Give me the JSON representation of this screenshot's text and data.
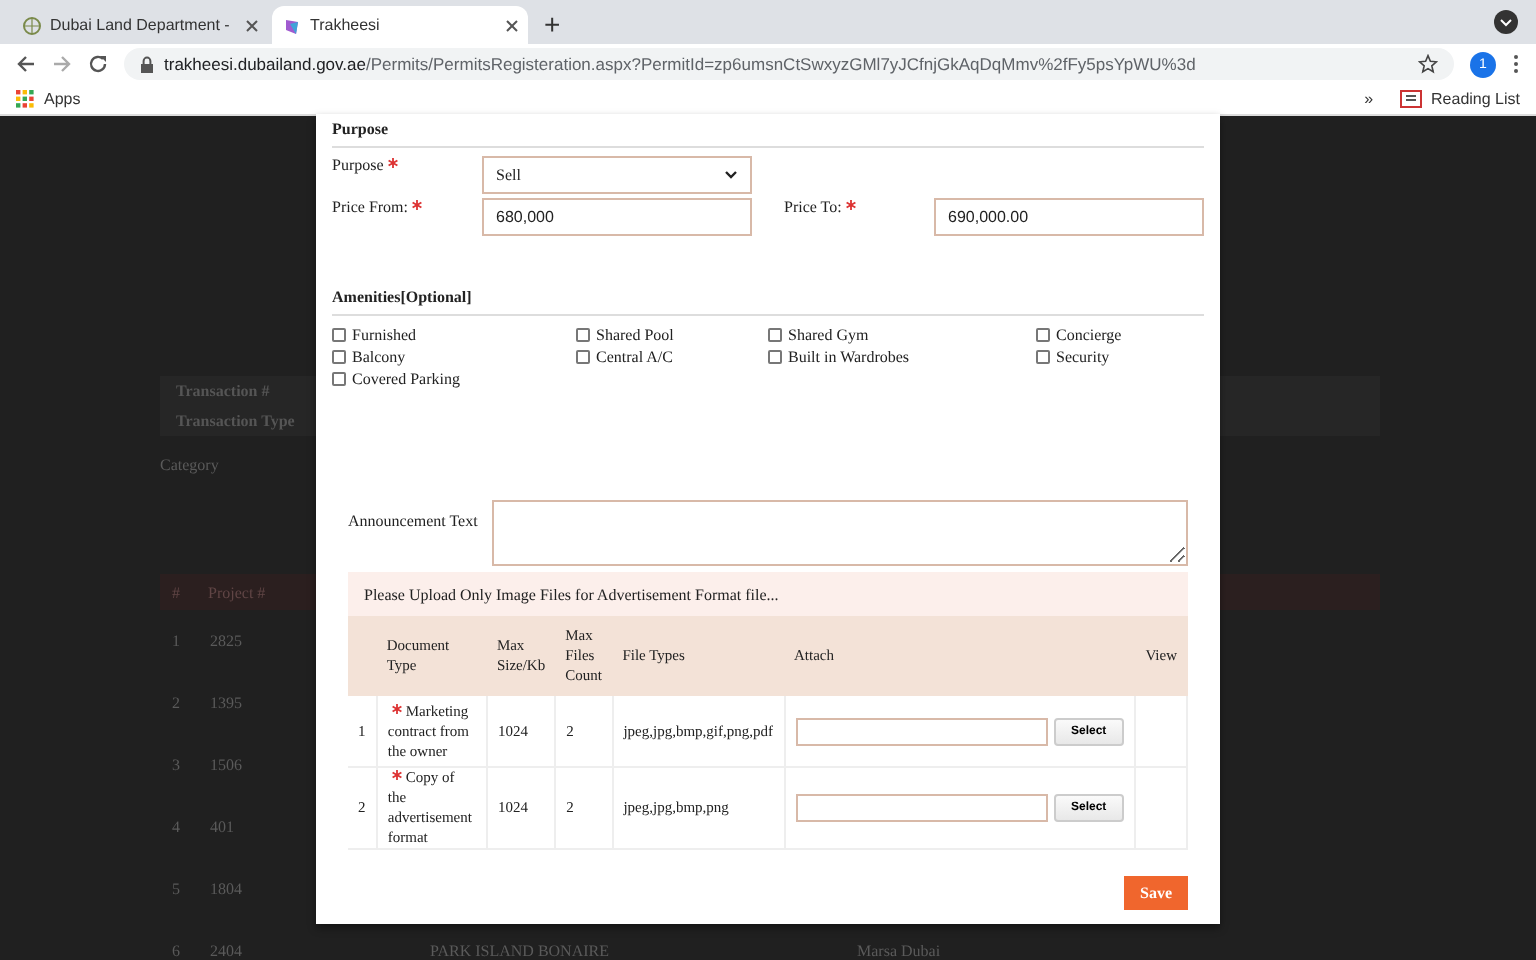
{
  "browser": {
    "tabs": [
      {
        "title": "Dubai Land Department -",
        "selected": false
      },
      {
        "title": "Trakheesi",
        "selected": true
      }
    ],
    "new_tab": "+",
    "url_host": "trakheesi.dubailand.gov.ae",
    "url_path": "/Permits/PermitsRegisteration.aspx?PermitId=zp6umsnCtSwxyzGMl7yJCfnjGkAqDqMmv%2fFy5psYpWU%3d",
    "profile": "1",
    "bookmarks": {
      "apps": "Apps",
      "more": "»",
      "reading_list": "Reading List"
    }
  },
  "background": {
    "info_labels": [
      "Transaction #",
      "Transaction Type"
    ],
    "category_label": "Category",
    "table_header": [
      "#",
      "Project #"
    ],
    "rows": [
      {
        "number": "1",
        "project": "2825"
      },
      {
        "number": "2",
        "project": "1395"
      },
      {
        "number": "3",
        "project": "1506"
      },
      {
        "number": "4",
        "project": "401"
      },
      {
        "number": "5",
        "project": "1804"
      },
      {
        "number": "6",
        "project": "2404",
        "name": "PARK ISLAND BONAIRE",
        "area": "Marsa Dubai"
      }
    ]
  },
  "modal": {
    "purpose_section": {
      "heading": "Purpose",
      "fields": [
        {
          "kind": "select",
          "label": "Purpose",
          "required": true,
          "value": "Sell"
        },
        {
          "kind": "input",
          "label": "Price From:",
          "required": true,
          "value": "680,000"
        },
        {
          "kind": "input",
          "label": "Price To:",
          "required": true,
          "value": "690,000.00"
        }
      ]
    },
    "amenities": {
      "heading": "Amenities[Optional]",
      "items": [
        {
          "label": "Furnished",
          "checked": false
        },
        {
          "label": "Shared Pool",
          "checked": false
        },
        {
          "label": "Shared Gym",
          "checked": false
        },
        {
          "label": "Concierge",
          "checked": false
        },
        {
          "label": "Balcony",
          "checked": false
        },
        {
          "label": "Central A/C",
          "checked": false
        },
        {
          "label": "Built in Wardrobes",
          "checked": false
        },
        {
          "label": "Security",
          "checked": false
        },
        {
          "label": "Covered Parking",
          "checked": false
        }
      ]
    },
    "announcement": {
      "label": "Announcement Text"
    },
    "notice": "Please Upload Only Image Files for Advertisement Format file...",
    "documents": {
      "columns": [
        "Document Type",
        "Max Size/Kb",
        "Max Files Count",
        "File Types",
        "Attach",
        "View"
      ],
      "rows": [
        {
          "number": "1",
          "required": true,
          "document_type": "Marketing contract from the owner",
          "max_size": "1024",
          "max_count": "2",
          "file_types": "jpeg,jpg,bmp,gif,png,pdf",
          "button": "Select"
        },
        {
          "number": "2",
          "required": true,
          "document_type": "Copy of the advertisement format",
          "max_size": "1024",
          "max_count": "2",
          "file_types": "jpeg,jpg,bmp,png",
          "button": "Select"
        }
      ]
    },
    "save": "Save"
  }
}
